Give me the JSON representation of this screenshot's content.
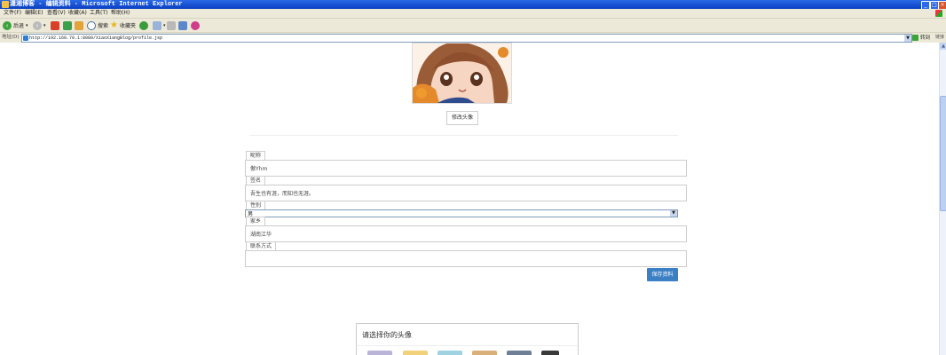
{
  "window": {
    "title": "潇湘博客 - 编辑资料 - Microsoft Internet Explorer",
    "minimize": "_",
    "maximize": "□",
    "close": "×"
  },
  "menu": [
    {
      "label": "文件(F)"
    },
    {
      "label": "编辑(E)"
    },
    {
      "label": "查看(V)"
    },
    {
      "label": "收藏(A)"
    },
    {
      "label": "工具(T)"
    },
    {
      "label": "帮助(H)"
    }
  ],
  "toolbar": {
    "back_label": "后退",
    "search_label": "搜索",
    "favorites_label": "收藏夹"
  },
  "address": {
    "label": "地址(D)",
    "url": "http://192.168.70.1:8080/XiaoXiangBlog/profile.jsp",
    "go_label": "转到",
    "links_label": "链接"
  },
  "profile": {
    "change_avatar_label": "修改头像",
    "fields": {
      "nickname": {
        "label": "昵称",
        "value": "傲Yhm"
      },
      "signature": {
        "label": "签名",
        "value": "吾生也有涯，而知也无涯。"
      },
      "gender": {
        "label": "性别",
        "value": "男"
      },
      "hometown": {
        "label": "家乡",
        "value": "湖南江华"
      },
      "contact": {
        "label": "联系方式",
        "value": ""
      }
    },
    "save_label": "保存资料"
  },
  "chooser": {
    "title": "请选择你的头像"
  },
  "colors": {
    "titlebar": "#0a3fc2",
    "chrome": "#ece9d8",
    "save_button": "#3b7fc4"
  }
}
